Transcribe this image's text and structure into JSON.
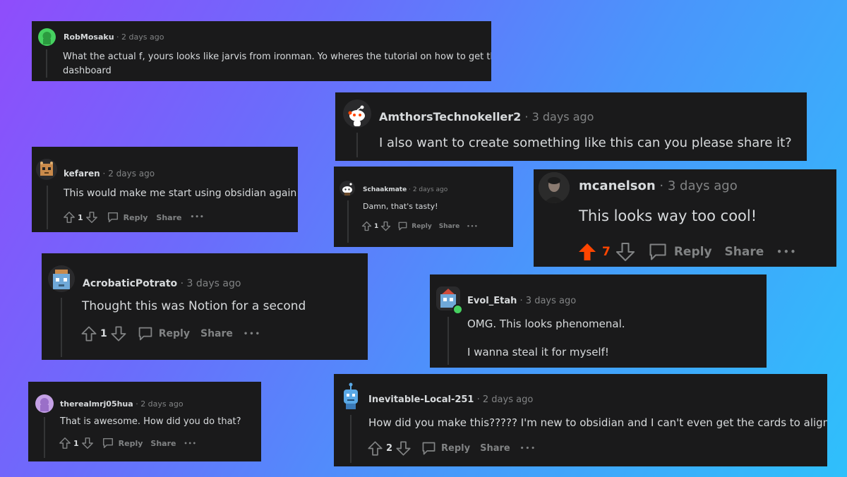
{
  "comments": [
    {
      "user": "RobMosaku",
      "time": "2 days ago",
      "text": "What the actual f, yours looks like jarvis from ironman. Yo wheres the tutorial on how to get this",
      "text2": "dashboard",
      "votes": ""
    },
    {
      "user": "AmthorsTechnokeller2",
      "time": "3 days ago",
      "text": "I also want to create something like this can you please share it?",
      "votes": ""
    },
    {
      "user": "kefaren",
      "time": "2 days ago",
      "text": "This would make me start using obsidian again",
      "votes": "1"
    },
    {
      "user": "Schaakmate",
      "time": "2 days ago",
      "text": "Damn, that's tasty!",
      "votes": "1"
    },
    {
      "user": "mcanelson",
      "time": "3 days ago",
      "text": "This looks way too cool!",
      "votes": "7"
    },
    {
      "user": "AcrobaticPotrato",
      "time": "3 days ago",
      "text": "Thought this was Notion for a second",
      "votes": "1"
    },
    {
      "user": "Evol_Etah",
      "time": "3 days ago",
      "text": "OMG. This looks phenomenal.",
      "text2": "I wanna steal it for myself!",
      "votes": ""
    },
    {
      "user": "therealmrj05hua",
      "time": "2 days ago",
      "text": "That is awesome. How did you do that?",
      "votes": "1"
    },
    {
      "user": "Inevitable-Local-251",
      "time": "2 days ago",
      "text": "How did you make this????? I'm new to obsidian and I can't even get the cards to align",
      "votes": "2"
    }
  ],
  "actions": {
    "reply": "Reply",
    "share": "Share",
    "more": "•••",
    "sep": "·"
  },
  "icons": {
    "upvote": "arrow-up-icon",
    "downvote": "arrow-down-icon",
    "reply": "comment-bubble-icon"
  },
  "colors": {
    "card": "#1a1a1b",
    "upvoted": "#ff4500",
    "muted": "#818384",
    "text": "#d7dadc"
  }
}
